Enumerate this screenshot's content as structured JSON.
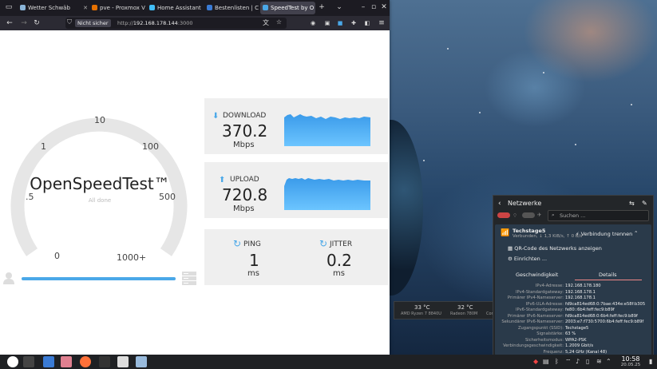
{
  "browser": {
    "tabs": [
      {
        "label": "Wetter Schwäb"
      },
      {
        "label": "pve - Proxmox V"
      },
      {
        "label": "Home Assistant"
      },
      {
        "label": "Bestenlisten | C"
      },
      {
        "label": "SpeedTest by O"
      }
    ],
    "new_tab": "+",
    "url_security": "Nicht sicher",
    "url_prefix": "http://",
    "url_host": "192.168.178.144",
    "url_suffix": ":3000"
  },
  "speedtest": {
    "brand": "OpenSpeedTest™",
    "status": "All done",
    "ticks": [
      "0",
      "1",
      ".5",
      "10",
      "100",
      "500",
      "1000+"
    ],
    "download": {
      "label": "DOWNLOAD",
      "value": "370.2",
      "unit": "Mbps"
    },
    "upload": {
      "label": "UPLOAD",
      "value": "720.8",
      "unit": "Mbps"
    },
    "ping": {
      "label": "PING",
      "value": "1",
      "unit": "ms"
    },
    "jitter": {
      "label": "JITTER",
      "value": "0.2",
      "unit": "ms"
    },
    "progress": 1.0
  },
  "network": {
    "title": "Netzwerke",
    "search_placeholder": "Suchen ...",
    "connection": {
      "name": "Techstage5",
      "status": "Verbunden, ↓ 1,3 KiB/s, ↑ 0 B/s",
      "disconnect": "Verbindung trennen"
    },
    "qr_label": "QR-Code des Netzwerks anzeigen",
    "setup_label": "Einrichten ...",
    "tab_speed": "Geschwindigkeit",
    "tab_details": "Details",
    "details": [
      {
        "k": "IPv4-Adresse:",
        "v": "192.168.178.180"
      },
      {
        "k": "IPv4-Standardgateway:",
        "v": "192.168.178.1"
      },
      {
        "k": "Primärer IPv4-Nameserver:",
        "v": "192.168.178.1"
      },
      {
        "k": "IPv6-ULA-Adresse:",
        "v": "fd9ca814ed68:0:7bae:434e:e58f:b305"
      },
      {
        "k": "IPv6-Standardgateway:",
        "v": "fe80::6b4:feff:fec9:b89f"
      },
      {
        "k": "Primärer IPv6-Nameserver:",
        "v": "fd9ca814ed68:0:6b4:feff:fec9:b89f"
      },
      {
        "k": "Sekundärer IPv6-Nameserver:",
        "v": "2003:e7:f730:5700:6b4:feff:fec9:b89f"
      },
      {
        "k": "Zugangspunkt (SSID):",
        "v": "Techstage5"
      },
      {
        "k": "Signalstärke:",
        "v": "63 %"
      },
      {
        "k": "Sicherheitsmodus:",
        "v": "WPA2-PSK"
      },
      {
        "k": "Verbindungsgeschwindigkeit:",
        "v": "1.2009 Gbit/s"
      },
      {
        "k": "Frequenz:",
        "v": "5,24 GHz (Kanal 48)"
      }
    ]
  },
  "sensors": [
    {
      "value": "33 °C",
      "label": "AMD Ryzen 7 8840U"
    },
    {
      "value": "32 °C",
      "label": "Radeon 780M"
    },
    {
      "value": "",
      "label": "Cor"
    }
  ],
  "clock": {
    "time": "10:58",
    "date": "20.05.25"
  },
  "colors": {
    "accent": "#4aa8e8",
    "card_bg": "#efefef",
    "panel_bg": "#232629"
  }
}
